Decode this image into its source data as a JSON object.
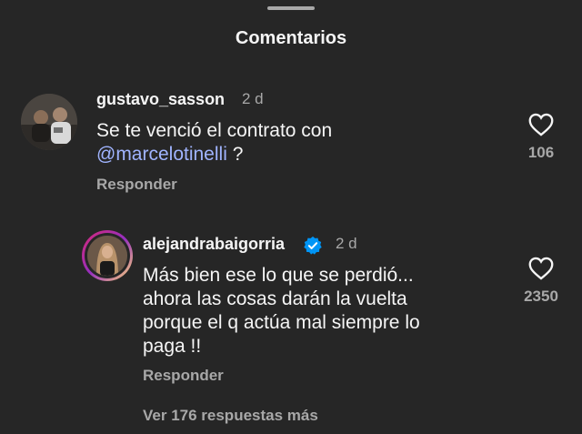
{
  "sheet": {
    "title": "Comentarios"
  },
  "comments": [
    {
      "username": "gustavo_sasson",
      "time": "2 d",
      "text_before": "Se te venció el contrato con ",
      "mention": "@marcelotinelli",
      "text_after": " ?",
      "reply_label": "Responder",
      "likes": "106",
      "avatar_icon": "user-photo-avatar"
    },
    {
      "username": "alejandrabaigorria",
      "verified": true,
      "time": "2 d",
      "text_lines": [
        "Más bien ese lo que se perdió...",
        "ahora las cosas darán la vuelta",
        "porque el q actúa mal siempre lo",
        "paga !!"
      ],
      "reply_label": "Responder",
      "likes": "2350",
      "avatar_icon": "user-photo-avatar-with-story-ring"
    }
  ],
  "view_more_label": "Ver 176 respuestas más",
  "colors": {
    "background": "#262626",
    "text_primary": "#f5f5f5",
    "text_secondary": "#a8a8a8",
    "mention": "#a0b4ff",
    "verified_badge": "#0095f6"
  }
}
